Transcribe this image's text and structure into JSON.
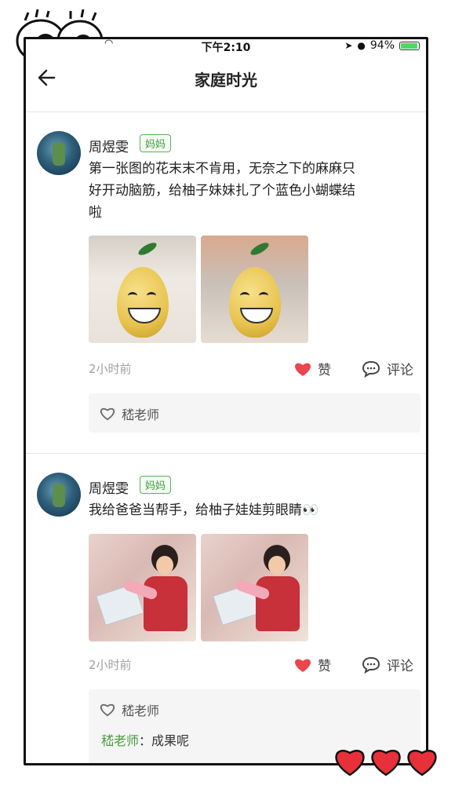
{
  "status_bar": {
    "time": "下午2:10",
    "battery": "94%"
  },
  "header": {
    "title": "家庭时光"
  },
  "posts": [
    {
      "author": "周煜雯",
      "role": "妈妈",
      "text_lines": [
        "第一张图的花末末不肯用，无奈之下的麻麻只",
        "好开动脑筋，给柚子妹妹扎了个蓝色小蝴蝶结",
        "啦"
      ],
      "time": "2小时前",
      "like_label": "赞",
      "comment_label": "评论",
      "liked_by": "嵇老师"
    },
    {
      "author": "周煜雯",
      "role": "妈妈",
      "text_lines": [
        "我给爸爸当帮手，给柚子娃娃剪眼睛👀"
      ],
      "time": "2小时前",
      "like_label": "赞",
      "comment_label": "评论",
      "liked_by": "嵇老师",
      "reply": {
        "who": "嵇老师",
        "sep": "：",
        "text": "成果呢"
      }
    }
  ],
  "colors": {
    "accent_green": "#4a9b3f",
    "like_red": "#e8474c",
    "battery_green": "#4cd964"
  },
  "icons": [
    "back-arrow-icon",
    "wifi-icon",
    "battery-icon",
    "heart-filled-icon",
    "comment-bubble-icon",
    "heart-outline-icon"
  ]
}
